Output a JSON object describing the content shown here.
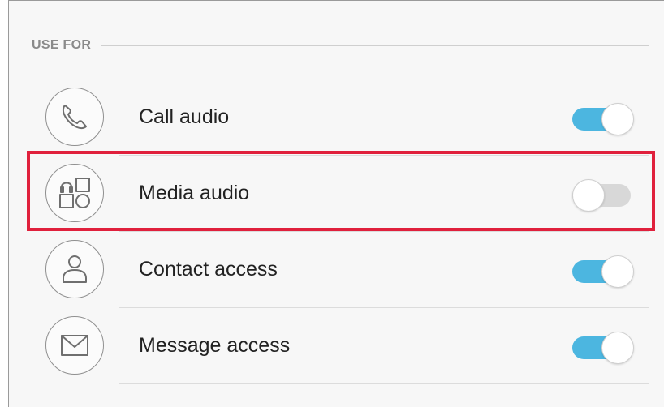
{
  "section": {
    "title": "USE FOR"
  },
  "items": [
    {
      "label": "Call audio",
      "icon": "phone-icon",
      "enabled": true
    },
    {
      "label": "Media audio",
      "icon": "media-audio-icon",
      "enabled": false
    },
    {
      "label": "Contact access",
      "icon": "contact-icon",
      "enabled": true
    },
    {
      "label": "Message access",
      "icon": "envelope-icon",
      "enabled": true
    }
  ],
  "colors": {
    "toggle_on": "#4cb6e0",
    "toggle_off": "#d8d8d8",
    "highlight": "#e0203c"
  }
}
